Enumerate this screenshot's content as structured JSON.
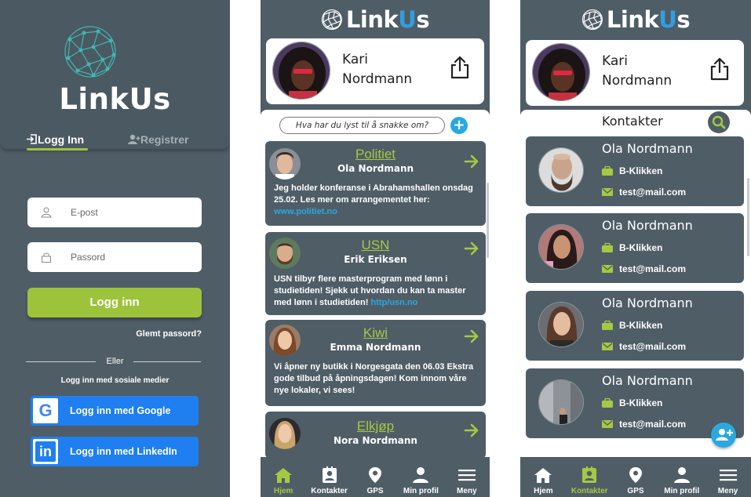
{
  "login": {
    "brand": "LinkUs",
    "tab_login": "Logg Inn",
    "tab_register": "Registrer",
    "email_placeholder": "E-post",
    "password_placeholder": "Passord",
    "login_button": "Logg inn",
    "forgot": "Glemt passord?",
    "or": "Eller",
    "social_text": "Logg inn med sosiale medier",
    "google_button": "Logg inn med Google",
    "linkedin_button": "Logg inn med LinkedIn",
    "google_letter": "G",
    "linkedin_letters": "in"
  },
  "app": {
    "brand_prefix": "Link",
    "brand_u": "U",
    "brand_suffix": "s",
    "user_first": "Kari",
    "user_last": "Nordmann",
    "accent": "#a6c942",
    "link_color": "#2aa8e0",
    "nav": [
      {
        "label": "Hjem",
        "icon": "home-icon"
      },
      {
        "label": "Kontakter",
        "icon": "contacts-icon"
      },
      {
        "label": "GPS",
        "icon": "map-pin-icon"
      },
      {
        "label": "Min profil",
        "icon": "person-icon"
      },
      {
        "label": "Meny",
        "icon": "menu-icon"
      }
    ]
  },
  "feed": {
    "compose_placeholder": "Hva har du lyst til å snakke om?",
    "compose_add": "+",
    "posts": [
      {
        "org": "Politiet",
        "name": "Ola Nordmann",
        "text": "Jeg holder konferanse i Abrahamshallen onsdag 25.02. Les mer om arrangementet her:",
        "link": "www.politiet.no"
      },
      {
        "org": "USN",
        "name": "Erik Eriksen",
        "text": "USN tilbyr flere masterprogram med lønn i studietiden! Sjekk ut hvordan du kan ta master med lønn i studietiden!",
        "link": "http/usn.no"
      },
      {
        "org": "Kiwi",
        "name": "Emma Nordmann",
        "text": "Vi åpner ny butikk i Norgesgata den 06.03 Ekstra gode tilbud på åpningsdagen! Kom innom våre nye lokaler, vi sees!",
        "link": ""
      },
      {
        "org": "Elkjøp",
        "name": "Nora Nordmann",
        "text": "",
        "link": ""
      }
    ]
  },
  "contacts": {
    "title": "Kontakter",
    "items": [
      {
        "name": "Ola Nordmann",
        "company": "B-Klikken",
        "email": "test@mail.com"
      },
      {
        "name": "Ola Nordmann",
        "company": "B-Klikken",
        "email": "test@mail.com"
      },
      {
        "name": "Ola Nordmann",
        "company": "B-Klikken",
        "email": "test@mail.com"
      },
      {
        "name": "Ola Nordmann",
        "company": "B-Klikken",
        "email": "test@mail.com"
      }
    ]
  }
}
